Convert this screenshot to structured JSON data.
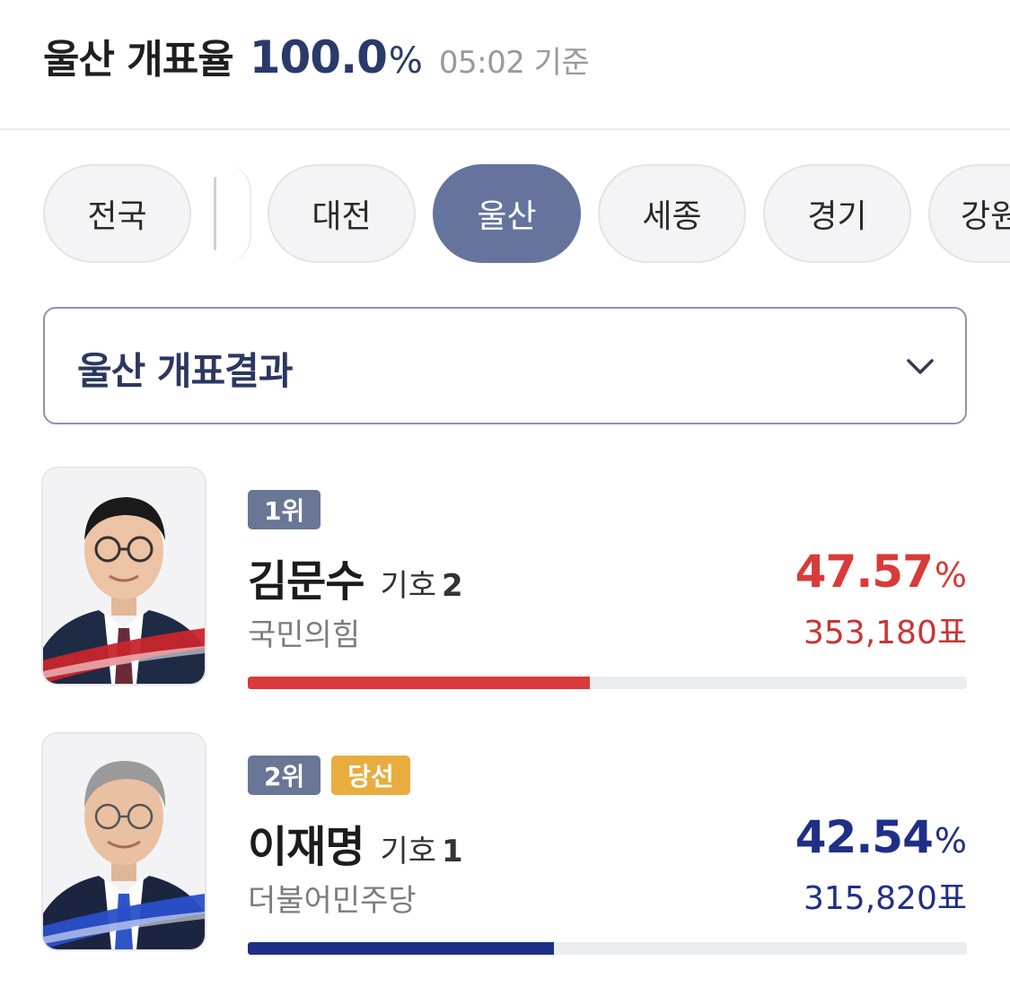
{
  "header": {
    "title": "울산 개표율",
    "rate": "100.0",
    "rate_unit": "%",
    "time": "05:02 기준"
  },
  "tabs": [
    {
      "label": "전국",
      "active": false
    },
    {
      "label": "대전",
      "active": false
    },
    {
      "label": "울산",
      "active": true
    },
    {
      "label": "세종",
      "active": false
    },
    {
      "label": "경기",
      "active": false
    },
    {
      "label": "강원",
      "active": false
    }
  ],
  "dropdown": {
    "label": "울산 개표결과",
    "icon": "chevron-down-icon"
  },
  "candidates": [
    {
      "rank": "1위",
      "name": "김문수",
      "symbol_label": "기호",
      "symbol_number": "2",
      "party": "국민의힘",
      "percent": "47.57",
      "percent_unit": "%",
      "votes": "353,180표",
      "share": 0.4757,
      "color": "#d93a3a",
      "photo_accent": "#c8252b"
    },
    {
      "rank": "2위",
      "winner_badge": "당선",
      "name": "이재명",
      "symbol_label": "기호",
      "symbol_number": "1",
      "party": "더불어민주당",
      "percent": "42.54",
      "percent_unit": "%",
      "votes": "315,820표",
      "share": 0.4254,
      "color": "#1f2f86",
      "photo_accent": "#2a4fc9"
    }
  ]
}
